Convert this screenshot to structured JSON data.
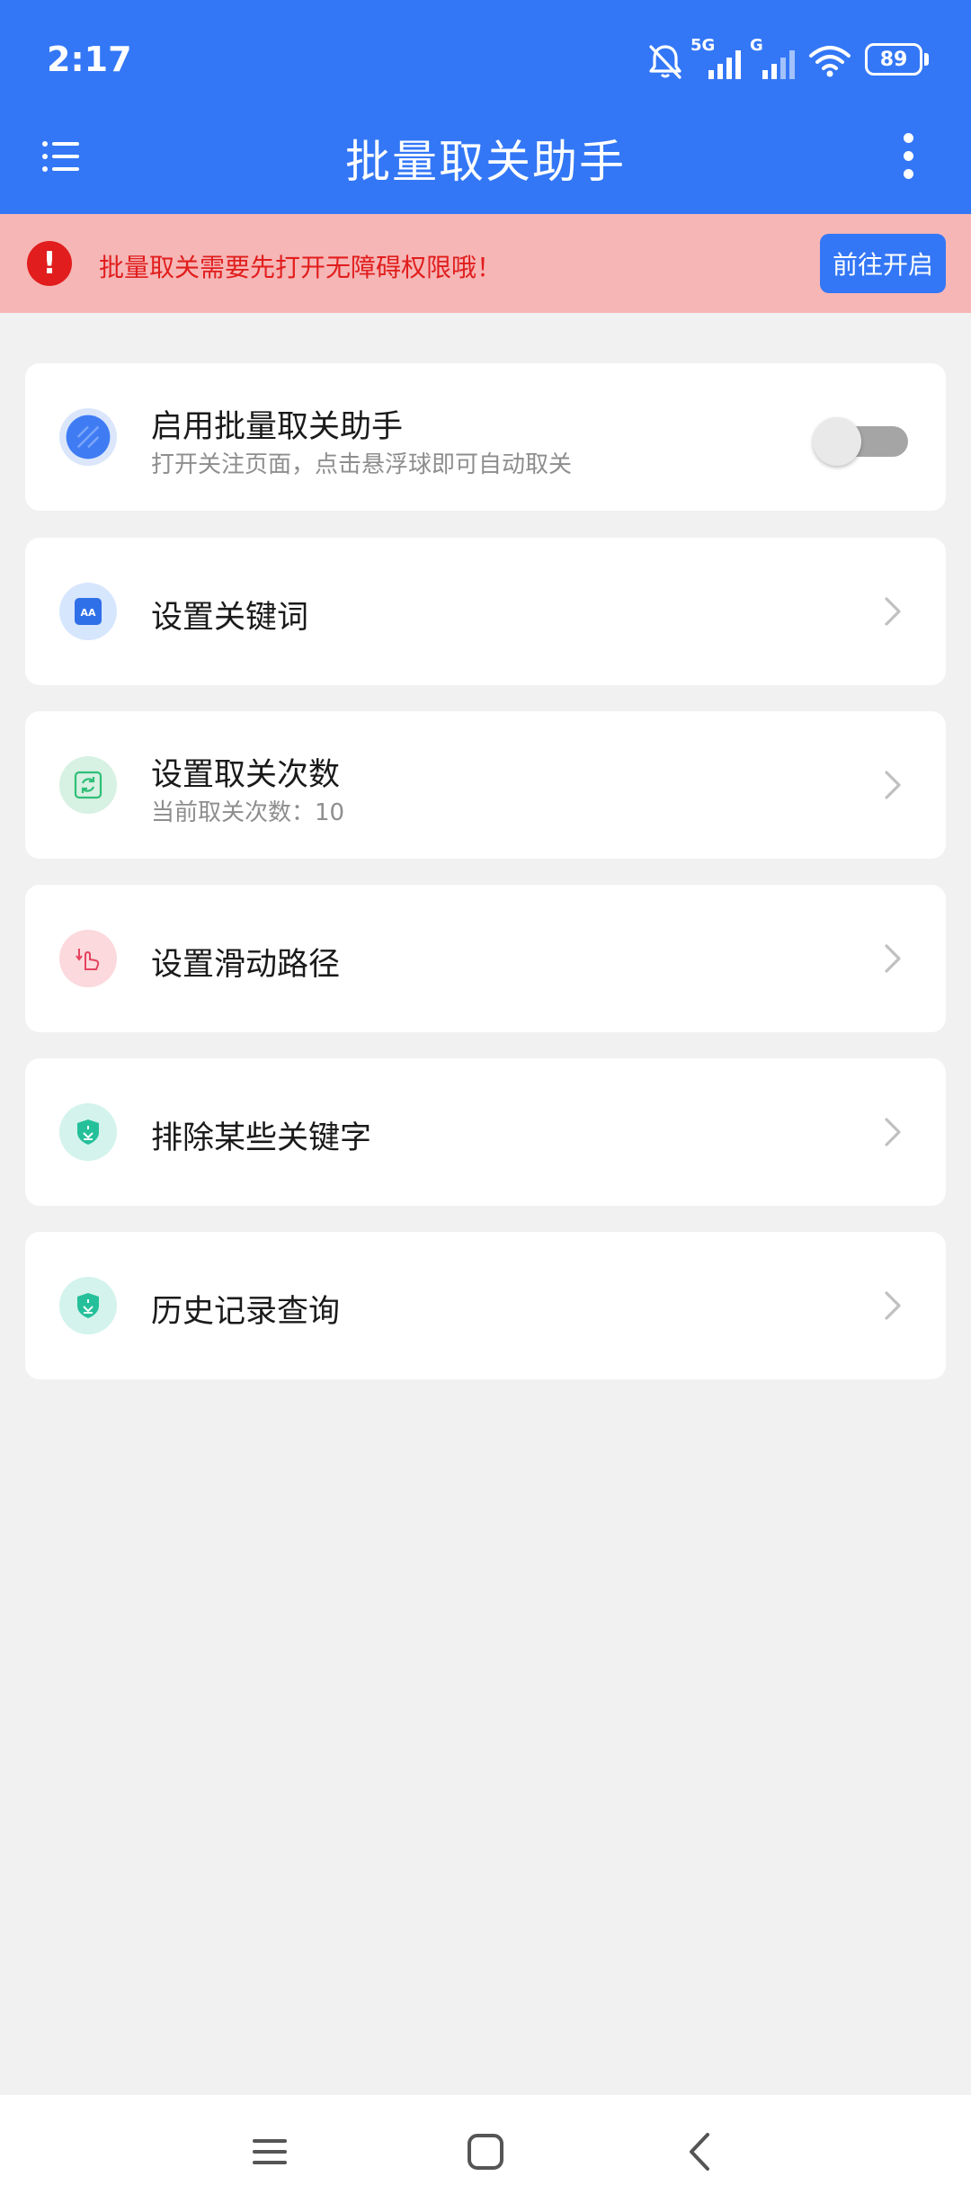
{
  "status_bar": {
    "time": "2:17",
    "network_1": "5G",
    "network_2": "G",
    "battery": "89",
    "icons": [
      "bell-off-icon",
      "signal-icon",
      "signal-icon",
      "wifi-icon",
      "battery-icon"
    ]
  },
  "app_bar": {
    "title": "批量取关助手",
    "left_icon": "list-menu-icon",
    "right_icon": "more-vertical-icon"
  },
  "banner": {
    "message": "批量取关需要先打开无障碍权限哦！",
    "button_label": "前往开启",
    "icon": "exclamation-icon"
  },
  "cards": [
    {
      "title": "启用批量取关助手",
      "subtitle": "打开关注页面，点击悬浮球即可自动取关",
      "icon": "assistant-icon",
      "toggle_on": false
    },
    {
      "title": "设置关键词",
      "icon": "keyword-icon"
    },
    {
      "title": "设置取关次数",
      "subtitle": "当前取关次数：10",
      "icon": "refresh-count-icon"
    },
    {
      "title": "设置滑动路径",
      "icon": "swipe-hand-icon"
    },
    {
      "title": "排除某些关键字",
      "icon": "shield-exclude-icon"
    },
    {
      "title": "历史记录查询",
      "icon": "shield-history-icon"
    }
  ],
  "colors": {
    "primary": "#3377f6",
    "banner_bg": "#f6b6b6",
    "warning": "#e11d1d",
    "background": "#f1f1f1"
  },
  "nav_bar": {
    "icons": [
      "nav-menu-icon",
      "nav-home-icon",
      "nav-back-icon"
    ]
  }
}
